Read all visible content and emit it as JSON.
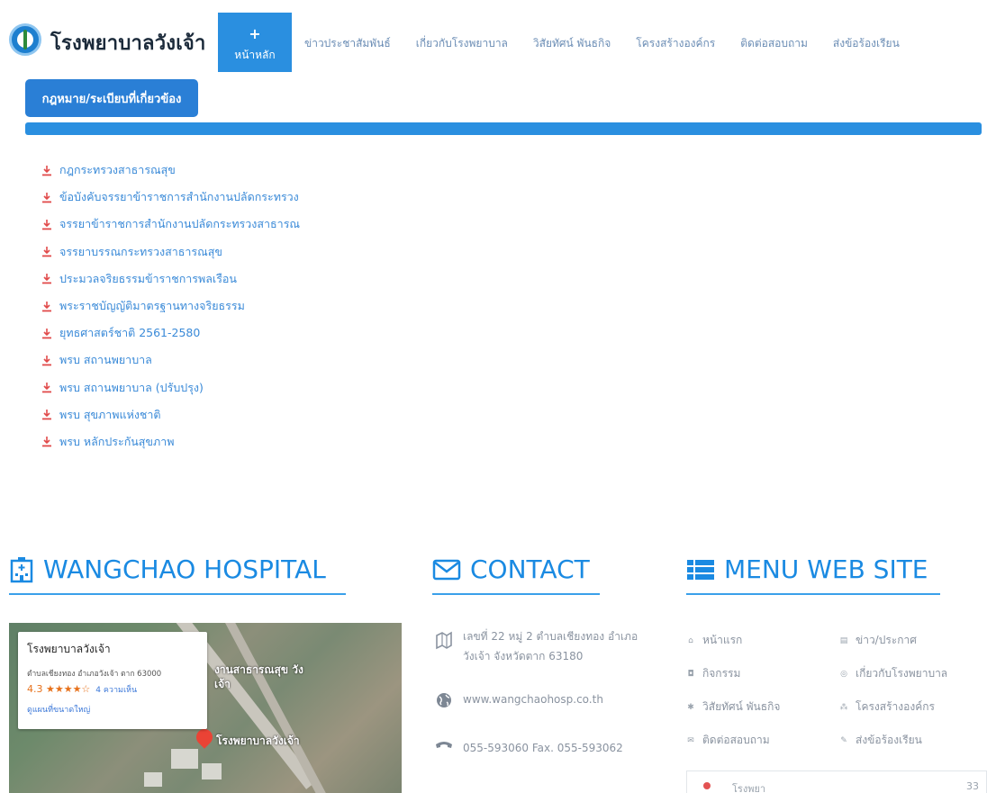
{
  "header": {
    "brand": "โรงพยาบาลวังเจ้า",
    "nav": [
      {
        "label": "หน้าหลัก",
        "active": true
      },
      {
        "label": "ข่าวประชาสัมพันธ์"
      },
      {
        "label": "เกี่ยวกับโรงพยาบาล"
      },
      {
        "label": "วิสัยทัศน์ พันธกิจ"
      },
      {
        "label": "โครงสร้างองค์กร"
      },
      {
        "label": "ติดต่อสอบถาม"
      },
      {
        "label": "ส่งข้อร้องเรียน"
      }
    ]
  },
  "section": {
    "title": "กฎหมาย/ระเบียบที่เกี่ยวข้อง"
  },
  "documents": [
    "กฎกระทรวงสาธารณสุข",
    "ข้อบังคับจรรยาข้าราชการสำนักงานปลัดกระทรวง",
    "จรรยาข้าราชการสำนักงานปลัดกระทรวงสาธารณ",
    "จรรยาบรรณกระทรวงสาธารณสุข",
    "ประมวลจริยธรรมข้าราชการพลเรือน",
    "พระราชบัญญัติมาตรฐานทางจริยธรรม",
    "ยุทธศาสตร์ชาติ 2561-2580",
    "พรบ สถานพยาบาล",
    "พรบ สถานพยาบาล (ปรับปรุง)",
    "พรบ สุขภาพแห่งชาติ",
    "พรบ หลักประกันสุขภาพ"
  ],
  "footer": {
    "hospital_title": "WANGCHAO HOSPITAL",
    "contact_title": "CONTACT",
    "menu_title": "MENU WEB SITE",
    "map": {
      "place_name": "โรงพยาบาลวังเจ้า",
      "address": "ตำบลเชียงทอง อำเภอวังเจ้า ตาก 63000",
      "rating": "4.3 ★★★★☆",
      "reviews": "4 ความเห็น",
      "larger_map": "ดูแผนที่ขนาดใหญ่",
      "label_building": "งานสาธารณสุข วังเจ้า",
      "label_pin": "โรงพยาบาลวังเจ้า"
    },
    "contact": {
      "address_line1": "เลขที่ 22 หมู่ 2 ตำบลเชียงทอง อำเภอ",
      "address_line2": "วังเจ้า จังหวัดตาก 63180",
      "website": "www.wangchaohosp.co.th",
      "phone": "055-593060 Fax. 055-593062"
    },
    "menu": [
      {
        "label": "หน้าแรก",
        "icon": "home-icon"
      },
      {
        "label": "ข่าว/ประกาศ",
        "icon": "list-icon"
      },
      {
        "label": "กิจกรรม",
        "icon": "camera-icon"
      },
      {
        "label": "เกี่ยวกับโรงพยาบาล",
        "icon": "info-icon"
      },
      {
        "label": "วิสัยทัศน์ พันธกิจ",
        "icon": "star-icon"
      },
      {
        "label": "โครงสร้างองค์กร",
        "icon": "sitemap-icon"
      },
      {
        "label": "ติดต่อสอบถาม",
        "icon": "mail-icon"
      },
      {
        "label": "ส่งข้อร้องเรียน",
        "icon": "edit-icon"
      }
    ],
    "bottom_text": "โรงพยา",
    "bottom_num": "33"
  }
}
